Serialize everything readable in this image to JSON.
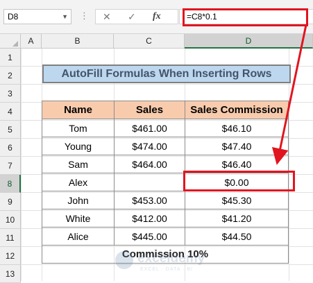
{
  "formula_bar": {
    "cell_reference": "D8",
    "formula": "=C8*0.1",
    "cancel_icon": "✕",
    "enter_icon": "✓",
    "fx_label": "fx",
    "dots": "⋮"
  },
  "columns": [
    "A",
    "B",
    "C",
    "D"
  ],
  "rows": [
    "1",
    "2",
    "3",
    "4",
    "5",
    "6",
    "7",
    "8",
    "9",
    "10",
    "11",
    "12",
    "13"
  ],
  "active_cell": {
    "column": "D",
    "row": "8"
  },
  "title": "AutoFill Formulas When Inserting Rows",
  "table": {
    "headers": [
      "Name",
      "Sales",
      "Sales Commission"
    ],
    "rows": [
      [
        "Tom",
        "$461.00",
        "$46.10"
      ],
      [
        "Young",
        "$474.00",
        "$47.40"
      ],
      [
        "Sam",
        "$464.00",
        "$46.40"
      ],
      [
        "Alex",
        "",
        "$0.00"
      ],
      [
        "John",
        "$453.00",
        "$45.30"
      ],
      [
        "White",
        "$412.00",
        "$41.20"
      ],
      [
        "Alice",
        "$445.00",
        "$44.50"
      ]
    ],
    "footer": "Commission 10%"
  },
  "watermark": {
    "brand": "exceldemy",
    "tagline": "EXCEL · DATA · BI"
  },
  "colors": {
    "title_fill": "#bdd7ee",
    "title_text": "#44546a",
    "header_fill": "#f8cbad",
    "annotation_red": "#e1151f",
    "excel_green": "#217346"
  }
}
